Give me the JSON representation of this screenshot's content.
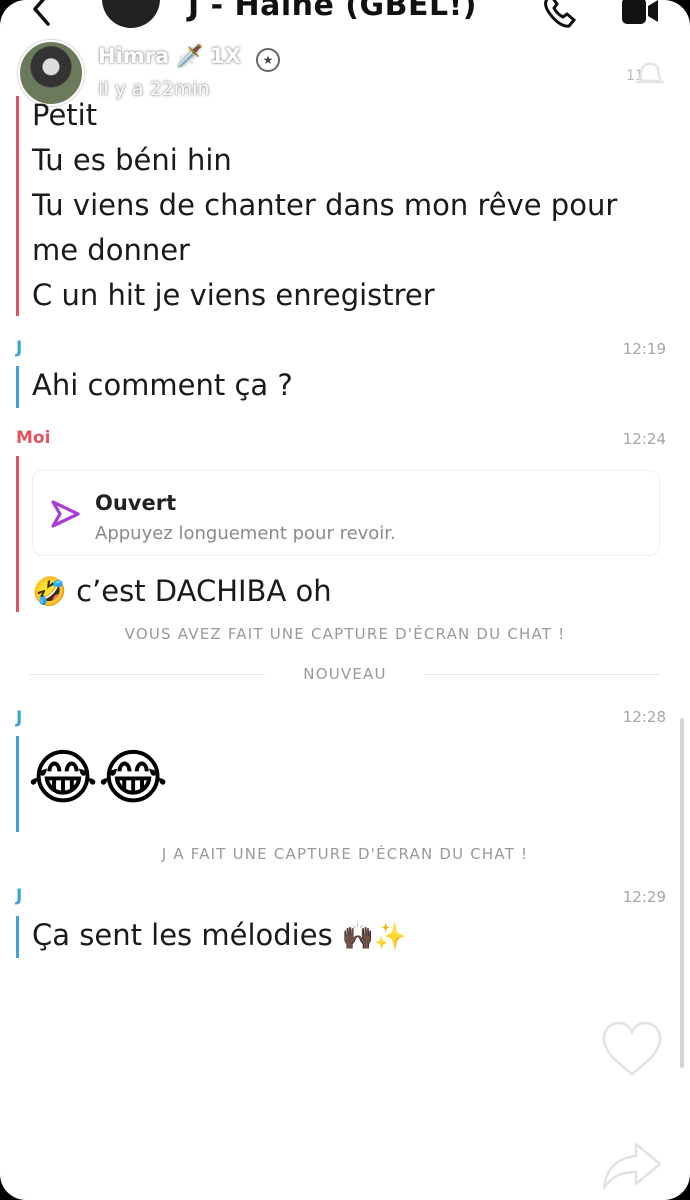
{
  "header": {
    "title": "J - Haine (GBEL!)",
    "back_icon": "chevron-left-icon",
    "call_icon": "phone-icon",
    "video_icon": "video-icon"
  },
  "story": {
    "username": "Himra",
    "badge": "1X",
    "emoji": "🗡️",
    "time_ago": "il y a 22min",
    "faded_time": "11"
  },
  "messages": {
    "first": {
      "lines": [
        "Petit",
        "Tu es béni hin",
        "Tu viens de chanter dans mon rêve pour",
        "me donner",
        "C un hit je viens enregistrer"
      ]
    },
    "m2": {
      "sender": "J",
      "time": "12:19",
      "text": "Ahi comment ça ?"
    },
    "m3": {
      "sender": "Moi",
      "time": "12:24",
      "snap_title": "Ouvert",
      "snap_sub": "Appuyez longuement pour revoir.",
      "emoji": "🤣",
      "text": "c’est DACHIBA oh"
    },
    "notice1": "VOUS AVEZ FAIT UNE CAPTURE D'ÉCRAN DU CHAT !",
    "new_label": "NOUVEAU",
    "m4": {
      "sender": "J",
      "time": "12:28",
      "emojis": "😂😂"
    },
    "notice2": "J A FAIT UNE CAPTURE D'ÉCRAN DU CHAT !",
    "m5": {
      "sender": "J",
      "time": "12:29",
      "text": "Ça sent les mélodies",
      "emojis": "🙌🏿✨"
    }
  },
  "colors": {
    "me": "#e0525f",
    "friend": "#3da2dc",
    "snap_purple": "#a63dd8"
  }
}
